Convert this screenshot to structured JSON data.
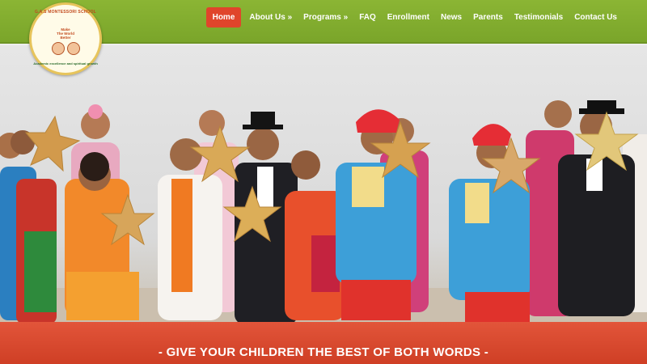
{
  "logo": {
    "ring_text": "G.A.S MONTESSORI SCHOOL",
    "motto": "Make\nThe World\nBetter",
    "sub_text": "Academic excellence and spiritual growth"
  },
  "nav": {
    "items": [
      {
        "label": "Home",
        "active": true
      },
      {
        "label": "About Us »",
        "active": false
      },
      {
        "label": "Programs »",
        "active": false
      },
      {
        "label": "FAQ",
        "active": false
      },
      {
        "label": "Enrollment",
        "active": false
      },
      {
        "label": "News",
        "active": false
      },
      {
        "label": "Parents",
        "active": false
      },
      {
        "label": "Testimonials",
        "active": false
      },
      {
        "label": "Contact Us",
        "active": false
      }
    ]
  },
  "hero": {
    "image_subject": "children-performing-on-stage-with-stars"
  },
  "banner": {
    "text": "- GIVE YOUR CHILDREN THE BEST OF BOTH WORDS -"
  },
  "colors": {
    "nav_green": "#7aa52a",
    "active_red": "#e0452b",
    "banner_red": "#d84a2f"
  }
}
